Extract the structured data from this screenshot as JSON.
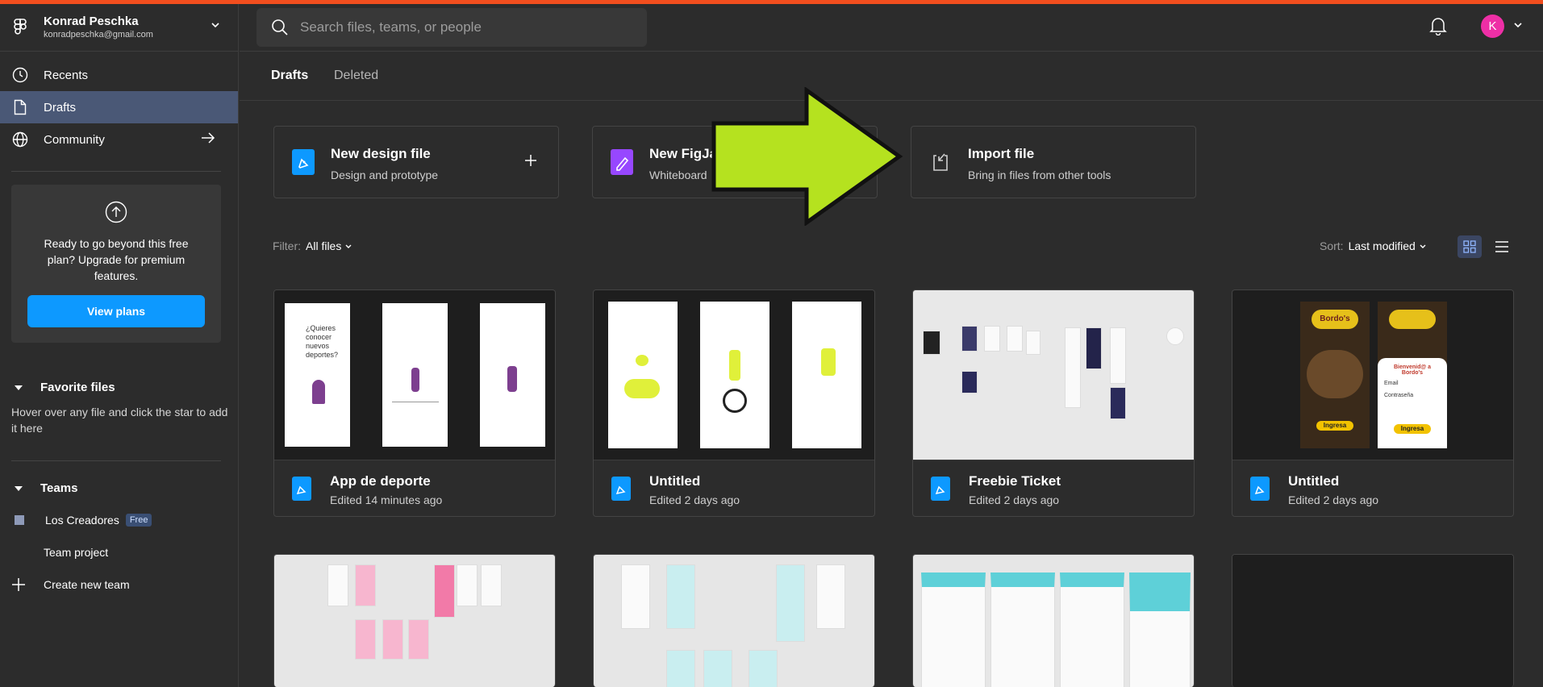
{
  "account": {
    "name": "Konrad Peschka",
    "email": "konradpeschka@gmail.com"
  },
  "nav": {
    "recents": "Recents",
    "drafts": "Drafts",
    "community": "Community"
  },
  "upgrade": {
    "text": "Ready to go beyond this free plan? Upgrade for premium features.",
    "button": "View plans"
  },
  "favorites": {
    "heading": "Favorite files",
    "hint": "Hover over any file and click the star to add it here"
  },
  "teams": {
    "heading": "Teams",
    "team_name": "Los Creadores",
    "team_badge": "Free",
    "project": "Team project",
    "create": "Create new team"
  },
  "search": {
    "placeholder": "Search files, teams, or people"
  },
  "user": {
    "initial": "K"
  },
  "tabs": {
    "drafts": "Drafts",
    "deleted": "Deleted"
  },
  "actions": [
    {
      "title": "New design file",
      "subtitle": "Design and prototype"
    },
    {
      "title": "New FigJam",
      "subtitle": "Whiteboard"
    },
    {
      "title": "Import file",
      "subtitle": "Bring in files from other tools"
    }
  ],
  "filter": {
    "label": "Filter:",
    "value": "All files"
  },
  "sort": {
    "label": "Sort:",
    "value": "Last modified"
  },
  "files": [
    {
      "name": "App de deporte",
      "edited": "Edited 14 minutes ago",
      "thumb_text": "¿Quieres conocer nuevos deportes?"
    },
    {
      "name": "Untitled",
      "edited": "Edited 2 days ago"
    },
    {
      "name": "Freebie Ticket",
      "edited": "Edited 2 days ago"
    },
    {
      "name": "Untitled",
      "edited": "Edited 2 days ago",
      "thumb_brand": "Bordo's",
      "thumb_welcome": "Bienvenid@ a Bordo's",
      "thumb_email": "Email",
      "thumb_pass": "Contraseña",
      "thumb_btn": "Ingresa"
    }
  ],
  "colors": {
    "accent": "#0d99ff",
    "active_nav": "#4a5876",
    "figma_stripe": "#f24e1e",
    "arrow": "#b5e21f",
    "avatar": "#ee2fa6"
  }
}
